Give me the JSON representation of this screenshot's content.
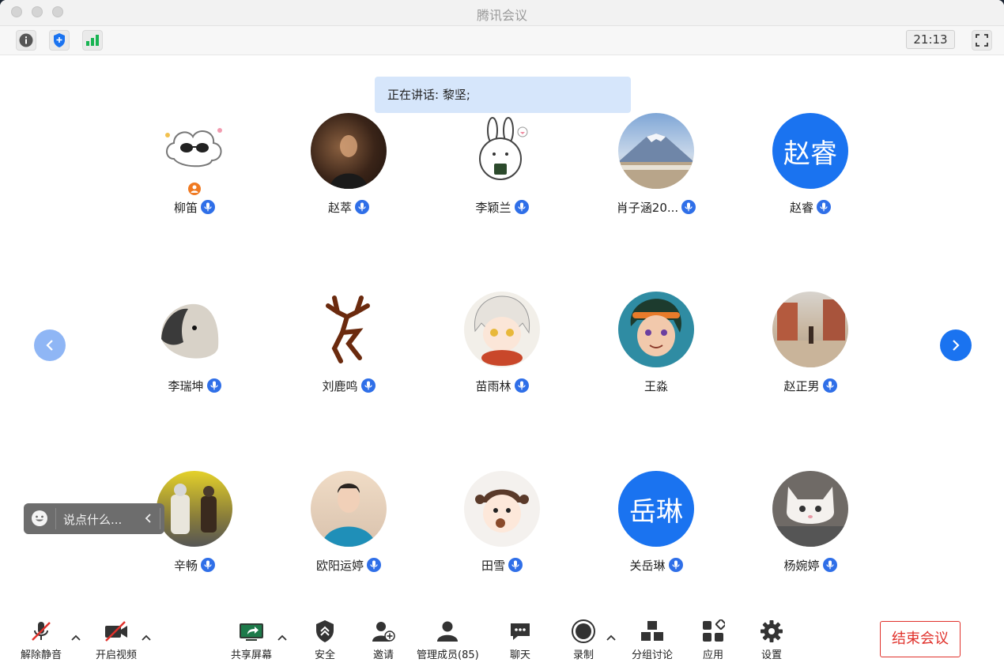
{
  "window": {
    "title": "腾讯会议"
  },
  "topbar": {
    "clock": "21:13",
    "icons": [
      "info-icon",
      "shield-icon",
      "signal-icon",
      "fullscreen-icon"
    ]
  },
  "speaking": {
    "text": "正在讲话: 黎坚;"
  },
  "participants": [
    {
      "name": "柳笛",
      "avatar": "image",
      "host": true,
      "mic": true
    },
    {
      "name": "赵萃",
      "avatar": "image",
      "mic": true
    },
    {
      "name": "李颖兰",
      "avatar": "image",
      "mic": true
    },
    {
      "name": "肖子涵20...",
      "avatar": "image",
      "mic": true
    },
    {
      "name": "赵睿",
      "avatar_text": "赵睿",
      "avatar_color": "#1a73f0",
      "mic": true
    },
    {
      "name": "李瑞坤",
      "avatar": "image",
      "mic": true
    },
    {
      "name": "刘鹿鸣",
      "avatar": "image",
      "mic": true
    },
    {
      "name": "苗雨林",
      "avatar": "image",
      "mic": true
    },
    {
      "name": "王淼",
      "avatar": "image",
      "mic": false
    },
    {
      "name": "赵正男",
      "avatar": "image",
      "mic": true
    },
    {
      "name": "辛畅",
      "avatar": "image",
      "mic": true
    },
    {
      "name": "欧阳运婷",
      "avatar": "image",
      "mic": true
    },
    {
      "name": "田雪",
      "avatar": "image",
      "mic": true
    },
    {
      "name": "关岳琳",
      "avatar_text": "岳琳",
      "avatar_color": "#1a73f0",
      "mic": true
    },
    {
      "name": "杨婉婷",
      "avatar": "image",
      "mic": true
    }
  ],
  "chat": {
    "placeholder": "说点什么..."
  },
  "toolbar": {
    "unmute": "解除静音",
    "start_video": "开启视频",
    "share": "共享屏幕",
    "security": "安全",
    "invite": "邀请",
    "members": "管理成员(85)",
    "chat": "聊天",
    "record": "录制",
    "breakout": "分组讨论",
    "apps": "应用",
    "settings": "设置",
    "end": "结束会议"
  },
  "colors": {
    "accent": "#1a73f0",
    "end": "#e0312b",
    "speaking_bg": "#d6e6fb"
  }
}
